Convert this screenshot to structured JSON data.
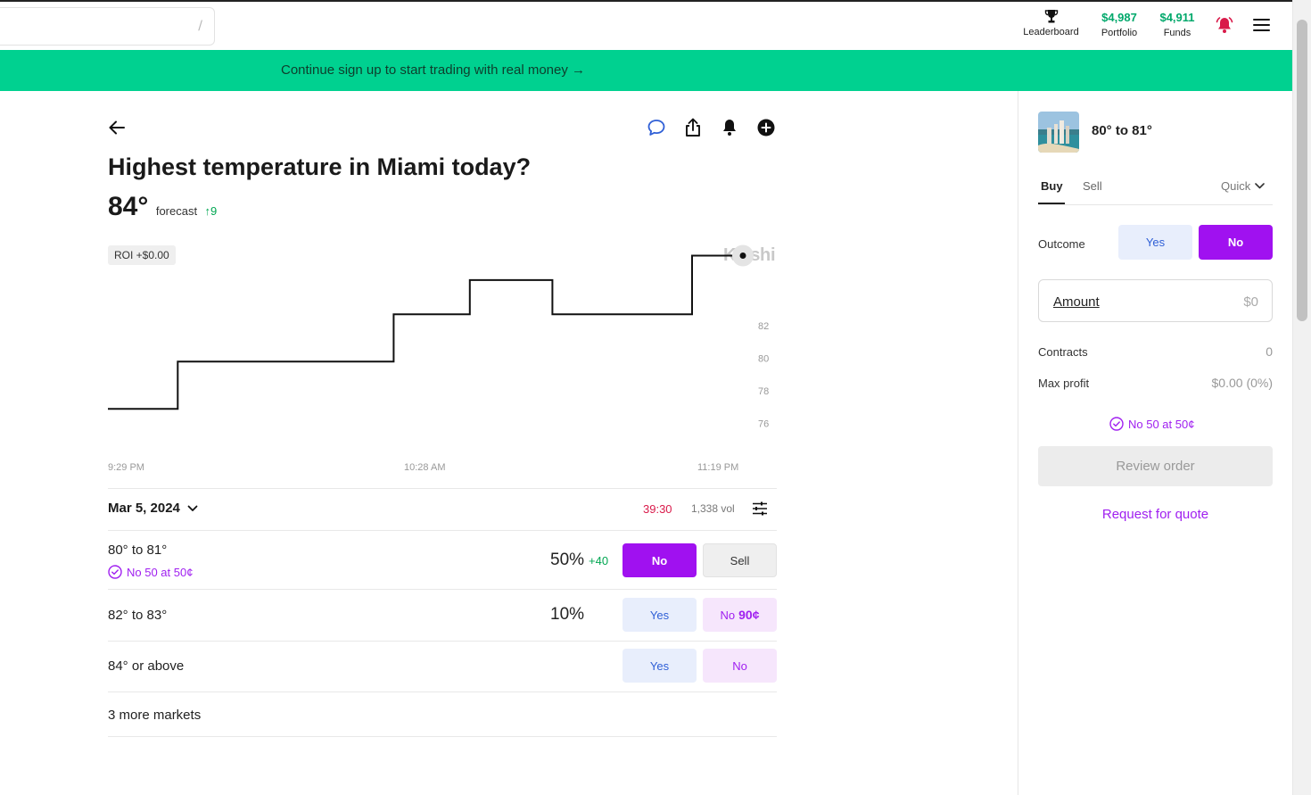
{
  "header": {
    "search": {
      "shortcut": "/"
    },
    "leaderboard_label": "Leaderboard",
    "portfolio": {
      "amount": "$4,987",
      "label": "Portfolio"
    },
    "funds": {
      "amount": "$4,911",
      "label": "Funds"
    }
  },
  "banner": {
    "text": "Continue sign up to start trading with real money →"
  },
  "market": {
    "title": "Highest temperature in Miami today?",
    "forecast_value": "84°",
    "forecast_label": "forecast",
    "forecast_change": "↑9",
    "roi": "ROI +$0.00",
    "watermark": "Kalshi"
  },
  "chart_data": {
    "type": "line",
    "title": "",
    "step": true,
    "x_tick_labels": [
      "9:29 PM",
      "10:28 AM",
      "11:19 PM"
    ],
    "y_ticks": [
      "76",
      "78",
      "80",
      "82"
    ],
    "ylim": [
      74.5,
      86
    ],
    "xlim": [
      0,
      100
    ],
    "series": [
      {
        "x": [
          0,
          11,
          11,
          45,
          45,
          57,
          57,
          70,
          70,
          92,
          92,
          100
        ],
        "values": [
          76.9,
          76.9,
          79.8,
          79.8,
          82.7,
          82.7,
          84.8,
          84.8,
          82.7,
          82.7,
          86.3,
          86.3
        ]
      }
    ]
  },
  "controls": {
    "date": "Mar 5, 2024",
    "timer": "39:30",
    "volume": "1,338 vol"
  },
  "outcomes": [
    {
      "label": "80° to 81°",
      "sub": "No 50 at 50¢",
      "pct": "50%",
      "delta": "+40",
      "btn1": "No",
      "btn2": "Sell"
    },
    {
      "label": "82° to 83°",
      "pct": "10%",
      "btn1": "Yes",
      "btn2_label": "No",
      "btn2_price": "90¢"
    },
    {
      "label": "84° or above",
      "btn1": "Yes",
      "btn2": "No"
    }
  ],
  "more_markets": "3 more markets",
  "panel": {
    "title": "80° to 81°",
    "tab_buy": "Buy",
    "tab_sell": "Sell",
    "mode": "Quick",
    "outcome_label": "Outcome",
    "yes": "Yes",
    "no": "No",
    "amount_label": "Amount",
    "amount_value": "$0",
    "contracts_label": "Contracts",
    "contracts_value": "0",
    "max_profit_label": "Max profit",
    "max_profit_value": "$0.00 (0%)",
    "order_note": "No 50 at 50¢",
    "review": "Review order",
    "rfq": "Request for quote"
  },
  "colors": {
    "accent": "#a011f0",
    "banner": "#00d190",
    "positive": "#00a651",
    "timer": "#d91a4a"
  }
}
